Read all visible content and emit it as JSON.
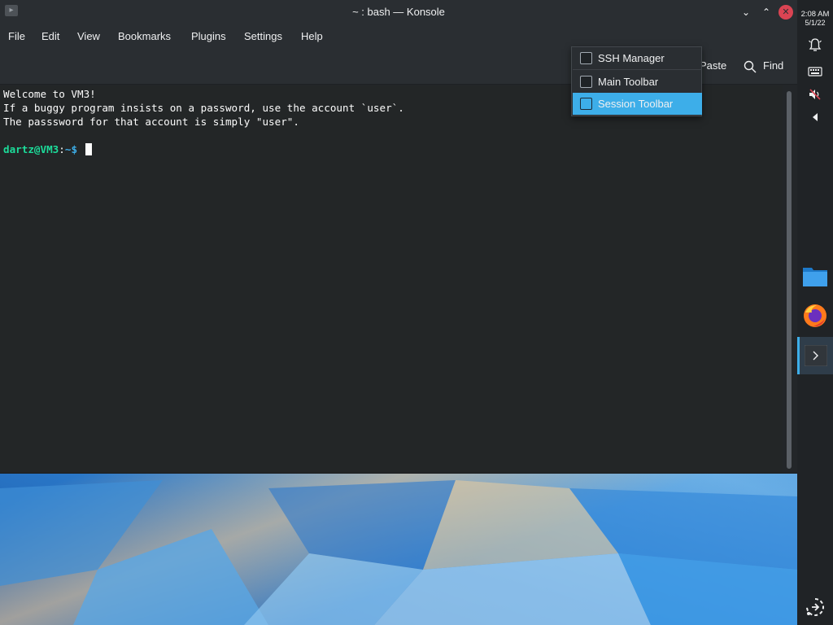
{
  "window": {
    "title": "~ : bash — Konsole",
    "controls": {
      "minimize": "⌄",
      "maximize": "⌃",
      "close": "✕"
    }
  },
  "menubar": {
    "items": [
      "File",
      "Edit",
      "View",
      "Bookmarks",
      "Plugins",
      "Settings",
      "Help"
    ]
  },
  "toolbar": {
    "paste_label": "Paste",
    "find_label": "Find"
  },
  "terminal": {
    "lines": [
      "Welcome to VM3!",
      "If a buggy program insists on a password, use the account `user`.",
      "The passsword for that account is simply \"user\"."
    ],
    "prompt": {
      "user_host": "dartz@VM3",
      "sep": ":",
      "path": "~",
      "symbol": "$"
    }
  },
  "popup_menu": {
    "items": [
      {
        "label": "SSH Manager",
        "checked": false,
        "selected": false
      },
      {
        "label": "Main Toolbar",
        "checked": false,
        "selected": false
      },
      {
        "label": "Session Toolbar",
        "checked": false,
        "selected": true
      }
    ]
  },
  "panel": {
    "clock_time": "2:08 AM",
    "clock_date": "5/1/22",
    "icons": [
      "notifications-icon",
      "keyboard-icon",
      "volume-muted-icon",
      "expand-tray-icon",
      "file-manager-icon",
      "firefox-icon",
      "konsole-task-icon",
      "application-launcher-icon"
    ]
  },
  "colors": {
    "accent": "#3daee9",
    "prompt_user": "#1cdc9a",
    "close_button": "#da4453",
    "terminal_bg": "#232627"
  }
}
